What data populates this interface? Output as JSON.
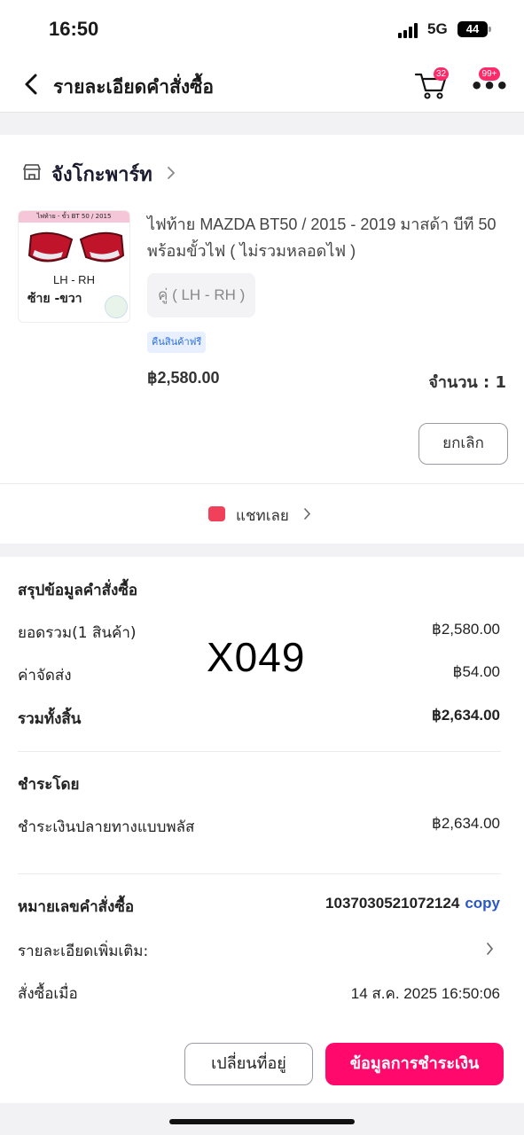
{
  "status": {
    "time": "16:50",
    "network": "5G",
    "battery": "44"
  },
  "nav": {
    "title": "รายละเอียดคำสั่งซื้อ",
    "cart_badge": "32",
    "more_badge": "99+"
  },
  "shop": {
    "name": "จังโกะพาร์ท"
  },
  "product": {
    "thumb_caption": "ไฟท้าย - ขั้ว BT 50 / 2015",
    "thumb_lh_rh": "LH - RH",
    "thumb_left_right": "ซ้าย -ขวา",
    "title": "ไฟท้าย MAZDA  BT50 / 2015 - 2019 มาสด้า บีที 50 พร้อมขั้วไฟ ( ไม่รวมหลอดไฟ )",
    "variant": "คู่ ( LH - RH )",
    "return_tag": "คืนสินค้าฟรี",
    "price": "฿2,580.00",
    "quantity": "จำนวน : 1",
    "cancel_label": "ยกเลิก"
  },
  "chat": {
    "label": "แชทเลย"
  },
  "summary": {
    "heading": "สรุปข้อมูลคำสั่งซื้อ",
    "subtotal_label": "ยอดรวม(1 สินค้า)",
    "subtotal_value": "฿2,580.00",
    "shipping_label": "ค่าจัดส่ง",
    "shipping_value": "฿54.00",
    "total_label": "รวมทั้งสิ้น",
    "total_value": "฿2,634.00",
    "watermark": "X049"
  },
  "payment": {
    "heading": "ชำระโดย",
    "method_label": "ชำระเงินปลายทางแบบพลัส",
    "method_value": "฿2,634.00"
  },
  "order": {
    "number_label": "หมายเลขคำสั่งซื้อ",
    "number_value": "1037030521072124",
    "copy_label": "copy",
    "details_label": "รายละเอียดเพิ่มเติม:",
    "ordered_at_label": "สั่งซื้อเมื่อ",
    "ordered_at_value": "14 ส.ค. 2025  16:50:06"
  },
  "actions": {
    "change_address": "เปลี่ยนที่อยู่",
    "payment_info": "ข้อมูลการชำระเงิน"
  },
  "colors": {
    "accent": "#ff0a6c",
    "badge": "#ff2a6a",
    "link": "#2a57c9"
  }
}
